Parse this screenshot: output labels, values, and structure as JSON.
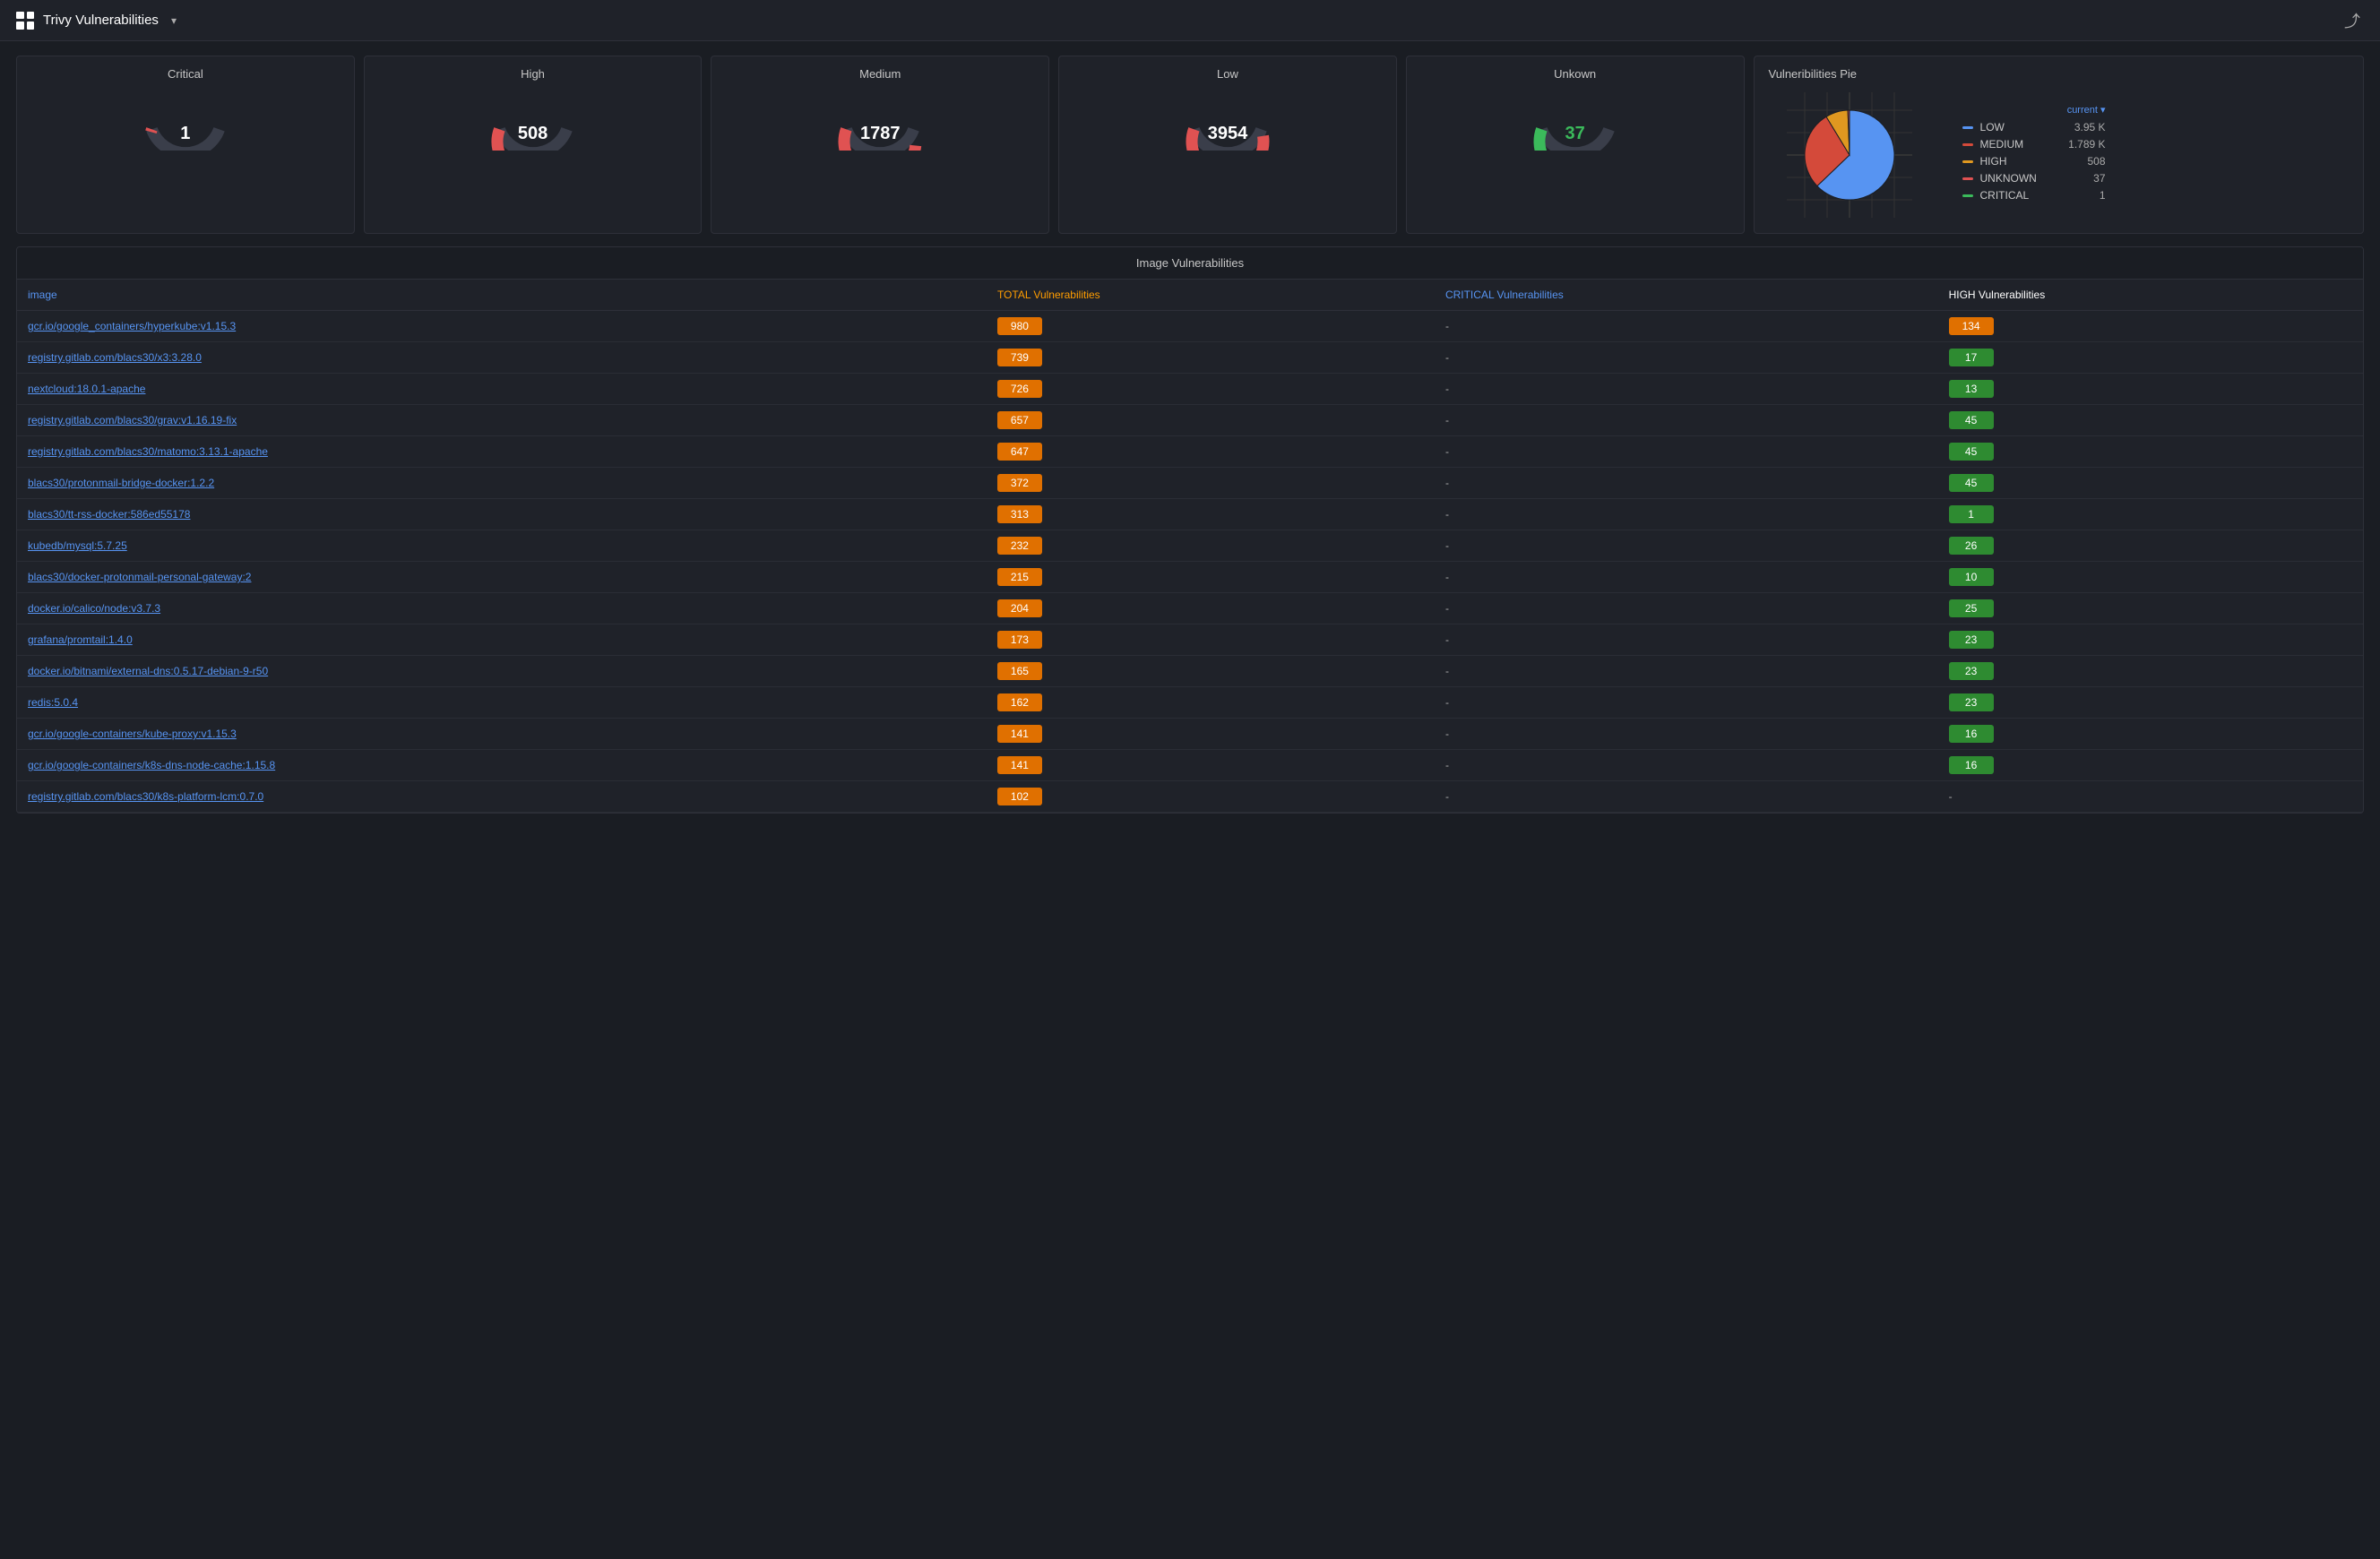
{
  "topbar": {
    "title": "Trivy Vulnerabilities",
    "chevron": "▾",
    "share_icon": "⤴"
  },
  "gauges": [
    {
      "id": "critical",
      "label": "Critical",
      "value": "1",
      "color": "#e05252",
      "pct": 0.02
    },
    {
      "id": "high",
      "label": "High",
      "value": "508",
      "color": "#e05252",
      "pct": 0.72
    },
    {
      "id": "medium",
      "label": "Medium",
      "value": "1787",
      "color": "#e05252",
      "pct": 0.88
    },
    {
      "id": "low",
      "label": "Low",
      "value": "3954",
      "color": "#e05252",
      "pct": 0.95
    },
    {
      "id": "unknown",
      "label": "Unkown",
      "value": "37",
      "color": "#3bba5b",
      "pct": 0.2
    }
  ],
  "pie": {
    "title": "Vulneribilities Pie",
    "legend_header": "current ▾",
    "items": [
      {
        "label": "LOW",
        "color": "#5794f2",
        "value": "3.95 K"
      },
      {
        "label": "MEDIUM",
        "color": "#d44a3a",
        "value": "1.789 K"
      },
      {
        "label": "HIGH",
        "color": "#e09820",
        "value": "508"
      },
      {
        "label": "UNKNOWN",
        "color": "#e05252",
        "value": "37"
      },
      {
        "label": "CRITICAL",
        "color": "#3bba5b",
        "value": "1"
      }
    ]
  },
  "table": {
    "title": "Image Vulnerabilities",
    "columns": {
      "image": "image",
      "total": "TOTAL Vulnerabilities",
      "critical": "CRITICAL Vulnerabilities",
      "high": "HIGH Vulnerabilities"
    },
    "rows": [
      {
        "image": "gcr.io/google_containers/hyperkube:v1.15.3",
        "total": "980",
        "total_color": "orange",
        "critical": "-",
        "high": "134",
        "high_color": "orange"
      },
      {
        "image": "registry.gitlab.com/blacs30/x3:3.28.0",
        "total": "739",
        "total_color": "orange",
        "critical": "-",
        "high": "17",
        "high_color": "green"
      },
      {
        "image": "nextcloud:18.0.1-apache",
        "total": "726",
        "total_color": "orange",
        "critical": "-",
        "high": "13",
        "high_color": "green"
      },
      {
        "image": "registry.gitlab.com/blacs30/grav:v1.16.19-fix",
        "total": "657",
        "total_color": "orange",
        "critical": "-",
        "high": "45",
        "high_color": "green"
      },
      {
        "image": "registry.gitlab.com/blacs30/matomo:3.13.1-apache",
        "total": "647",
        "total_color": "orange",
        "critical": "-",
        "high": "45",
        "high_color": "green"
      },
      {
        "image": "blacs30/protonmail-bridge-docker:1.2.2",
        "total": "372",
        "total_color": "orange",
        "critical": "-",
        "high": "45",
        "high_color": "green"
      },
      {
        "image": "blacs30/tt-rss-docker:586ed55178",
        "total": "313",
        "total_color": "orange",
        "critical": "-",
        "high": "1",
        "high_color": "green"
      },
      {
        "image": "kubedb/mysql:5.7.25",
        "total": "232",
        "total_color": "orange",
        "critical": "-",
        "high": "26",
        "high_color": "green"
      },
      {
        "image": "blacs30/docker-protonmail-personal-gateway:2",
        "total": "215",
        "total_color": "orange",
        "critical": "-",
        "high": "10",
        "high_color": "green"
      },
      {
        "image": "docker.io/calico/node:v3.7.3",
        "total": "204",
        "total_color": "orange",
        "critical": "-",
        "high": "25",
        "high_color": "green"
      },
      {
        "image": "grafana/promtail:1.4.0",
        "total": "173",
        "total_color": "orange",
        "critical": "-",
        "high": "23",
        "high_color": "green"
      },
      {
        "image": "docker.io/bitnami/external-dns:0.5.17-debian-9-r50",
        "total": "165",
        "total_color": "orange",
        "critical": "-",
        "high": "23",
        "high_color": "green"
      },
      {
        "image": "redis:5.0.4",
        "total": "162",
        "total_color": "orange",
        "critical": "-",
        "high": "23",
        "high_color": "green"
      },
      {
        "image": "gcr.io/google-containers/kube-proxy:v1.15.3",
        "total": "141",
        "total_color": "orange",
        "critical": "-",
        "high": "16",
        "high_color": "green"
      },
      {
        "image": "gcr.io/google-containers/k8s-dns-node-cache:1.15.8",
        "total": "141",
        "total_color": "orange",
        "critical": "-",
        "high": "16",
        "high_color": "green"
      },
      {
        "image": "registry.gitlab.com/blacs30/k8s-platform-lcm:0.7.0",
        "total": "102",
        "total_color": "orange",
        "critical": "-",
        "high": "-",
        "high_color": "none"
      }
    ]
  }
}
